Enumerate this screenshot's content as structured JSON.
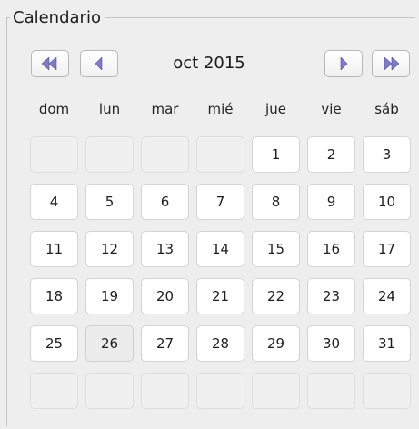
{
  "calendar": {
    "title": "Calendario",
    "month_label": "oct 2015",
    "nav": {
      "prev_year_icon": "double-left-arrow-icon",
      "prev_month_icon": "left-arrow-icon",
      "next_month_icon": "right-arrow-icon",
      "next_year_icon": "double-right-arrow-icon"
    },
    "weekdays": [
      "dom",
      "lun",
      "mar",
      "mié",
      "jue",
      "vie",
      "sáb"
    ],
    "weeks": [
      [
        "",
        "",
        "",
        "",
        "1",
        "2",
        "3"
      ],
      [
        "4",
        "5",
        "6",
        "7",
        "8",
        "9",
        "10"
      ],
      [
        "11",
        "12",
        "13",
        "14",
        "15",
        "16",
        "17"
      ],
      [
        "18",
        "19",
        "20",
        "21",
        "22",
        "23",
        "24"
      ],
      [
        "25",
        "26",
        "27",
        "28",
        "29",
        "30",
        "31"
      ],
      [
        "",
        "",
        "",
        "",
        "",
        "",
        ""
      ]
    ],
    "highlighted_day": "26"
  },
  "colors": {
    "arrow": "#7d7cc4",
    "background": "#eeeeee"
  }
}
